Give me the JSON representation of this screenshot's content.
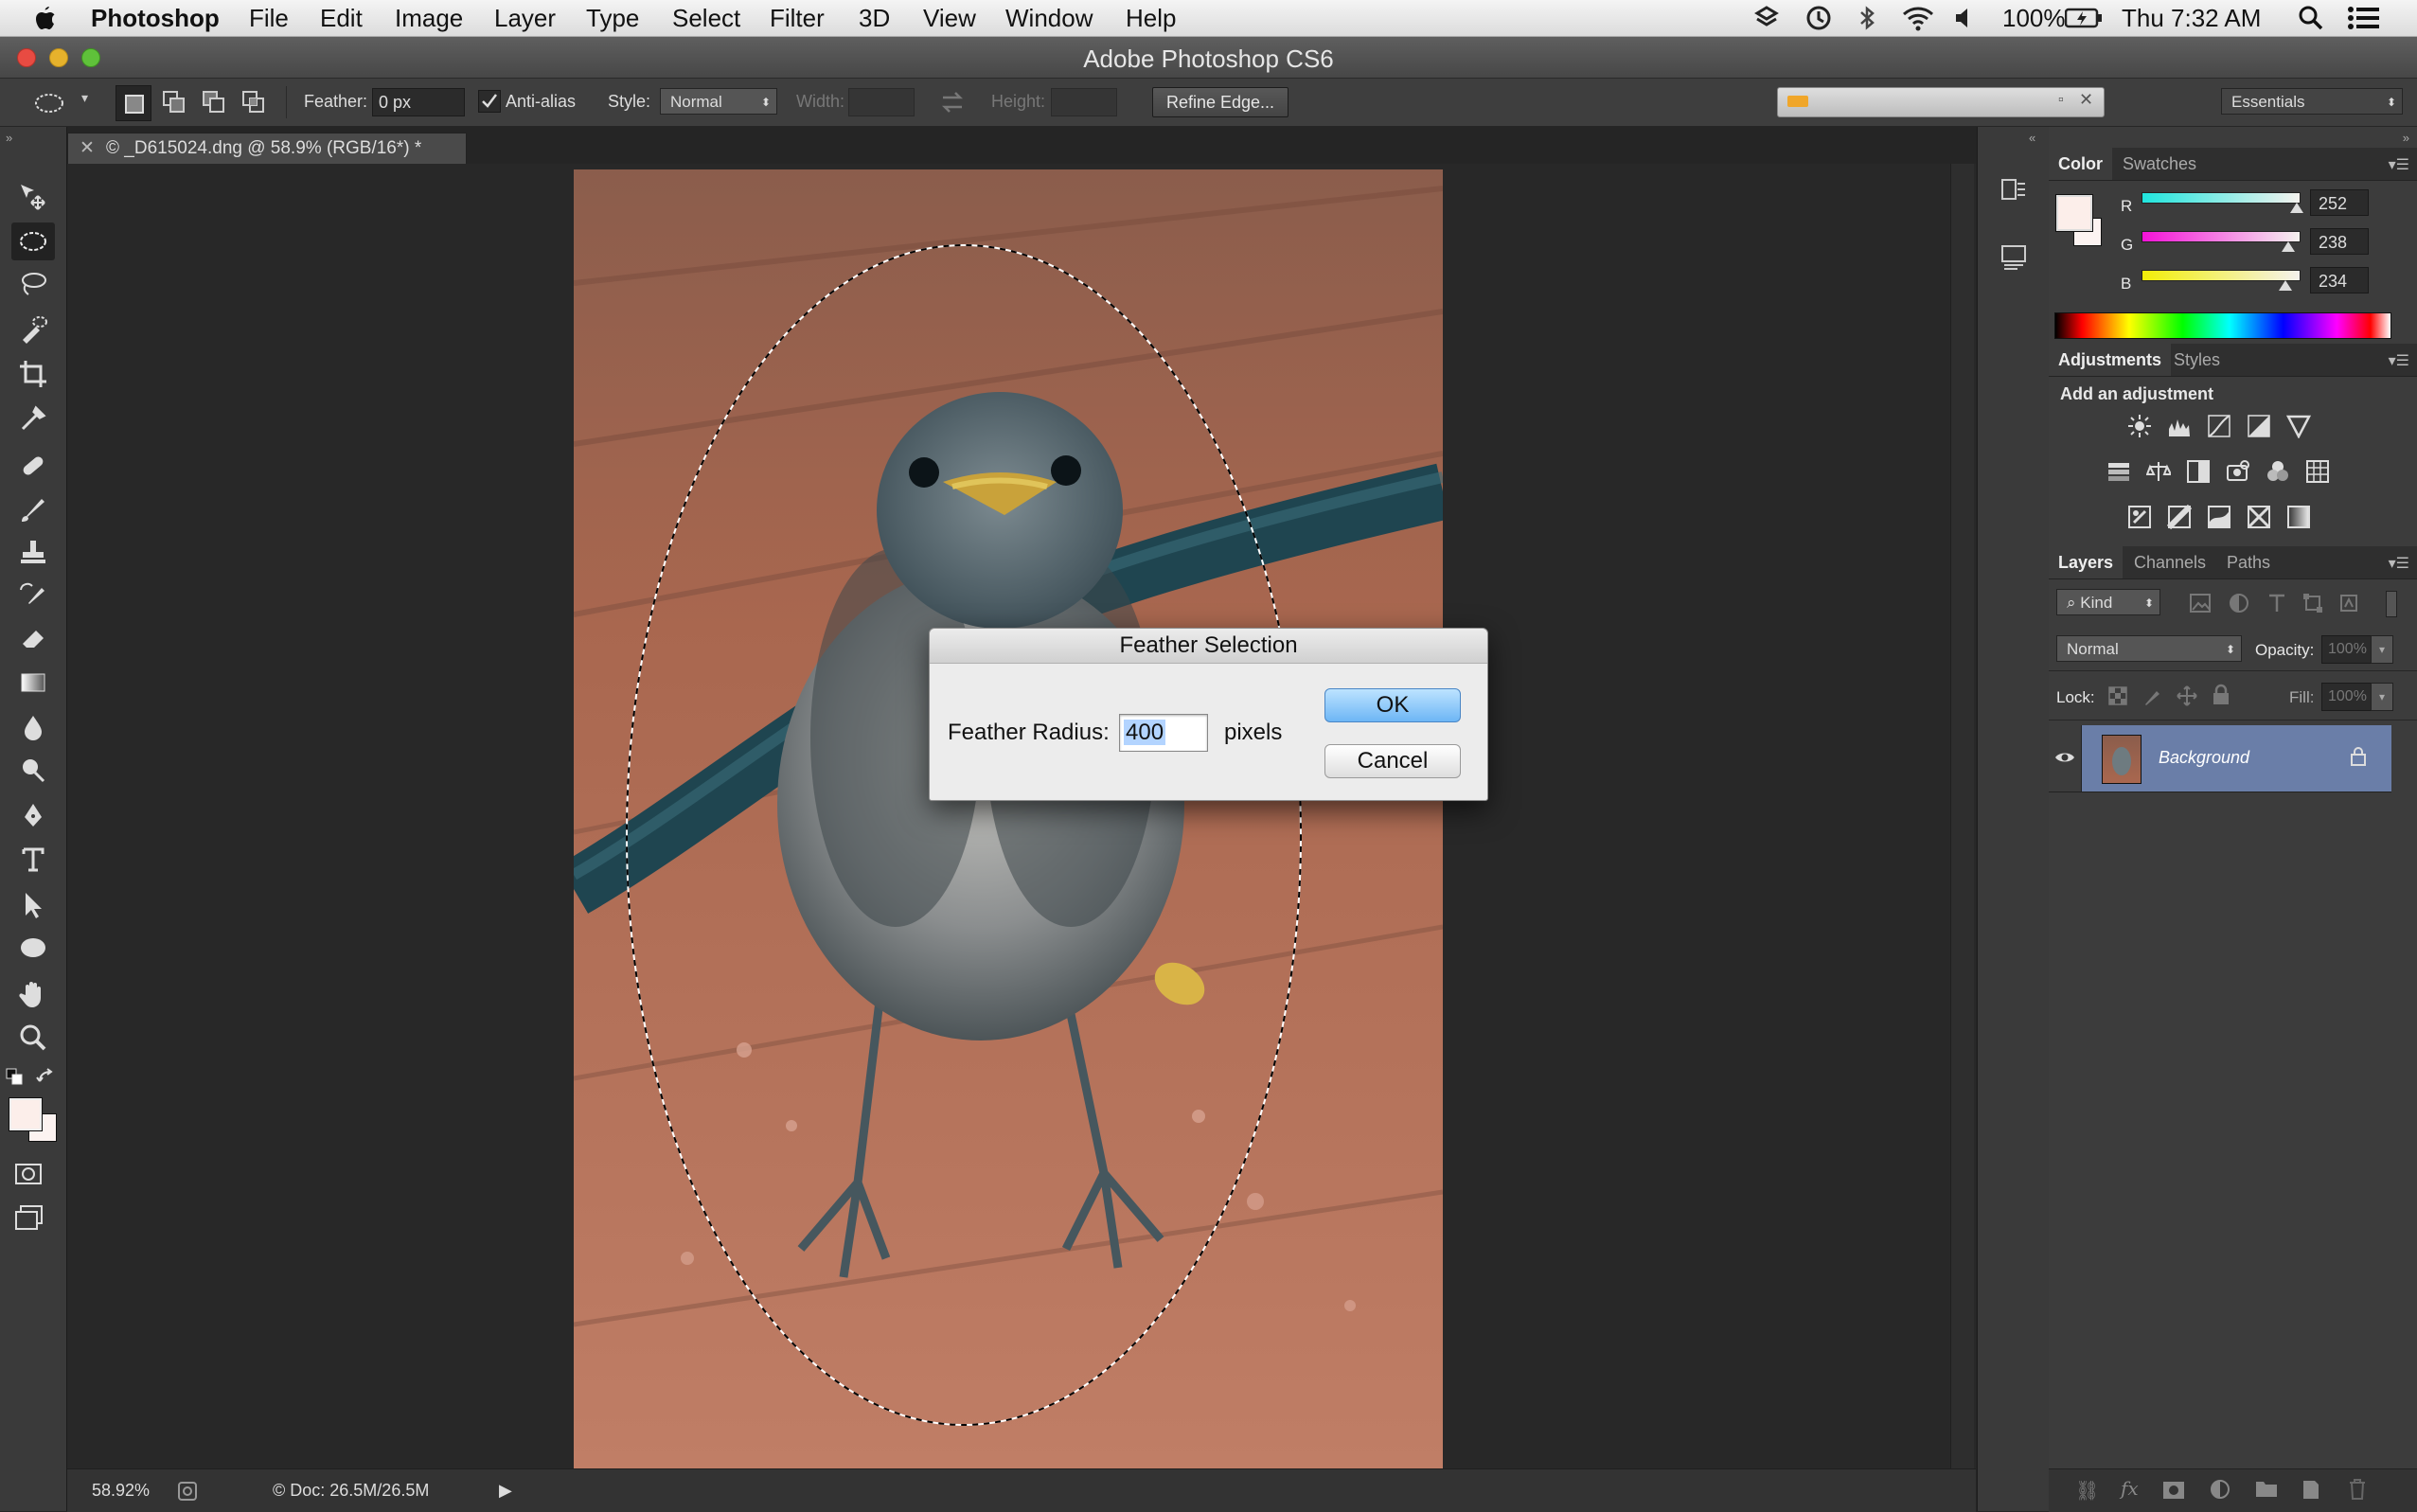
{
  "menubar": {
    "app_name": "Photoshop",
    "items": [
      "File",
      "Edit",
      "Image",
      "Layer",
      "Type",
      "Select",
      "Filter",
      "3D",
      "View",
      "Window",
      "Help"
    ],
    "battery": "100%",
    "clock": "Thu 7:32 AM"
  },
  "window": {
    "title": "Adobe Photoshop CS6"
  },
  "options_bar": {
    "feather_label": "Feather:",
    "feather_value": "0 px",
    "antialias_label": "Anti-alias",
    "antialias_checked": true,
    "style_label": "Style:",
    "style_value": "Normal",
    "width_label": "Width:",
    "height_label": "Height:",
    "refine_edge_label": "Refine Edge...",
    "workspace": "Essentials"
  },
  "document": {
    "tab_title": "© _D615024.dng @ 58.9% (RGB/16*) *",
    "zoom": "58.92%",
    "doc_info": "© Doc: 26.5M/26.5M"
  },
  "dialog": {
    "title": "Feather Selection",
    "radius_label": "Feather Radius:",
    "radius_value": "400",
    "unit": "pixels",
    "ok_label": "OK",
    "cancel_label": "Cancel"
  },
  "color_panel": {
    "tabs": [
      "Color",
      "Swatches"
    ],
    "channels": [
      {
        "label": "R",
        "value": "252",
        "fraction": 0.988
      },
      {
        "label": "G",
        "value": "238",
        "fraction": 0.933
      },
      {
        "label": "B",
        "value": "234",
        "fraction": 0.918
      }
    ],
    "foreground": "#fceeea"
  },
  "adjustments_panel": {
    "tabs": [
      "Adjustments",
      "Styles"
    ],
    "heading": "Add an adjustment"
  },
  "layers_panel": {
    "tabs": [
      "Layers",
      "Channels",
      "Paths"
    ],
    "filter_kind": "Kind",
    "blend_mode": "Normal",
    "opacity_label": "Opacity:",
    "opacity_value": "100%",
    "lock_label": "Lock:",
    "fill_label": "Fill:",
    "fill_value": "100%",
    "layers": [
      {
        "name": "Background",
        "visible": true,
        "locked": true
      }
    ]
  },
  "colors": {
    "accent_selection": "#6a7ea8",
    "dialog_ok": "#6db6f5"
  }
}
